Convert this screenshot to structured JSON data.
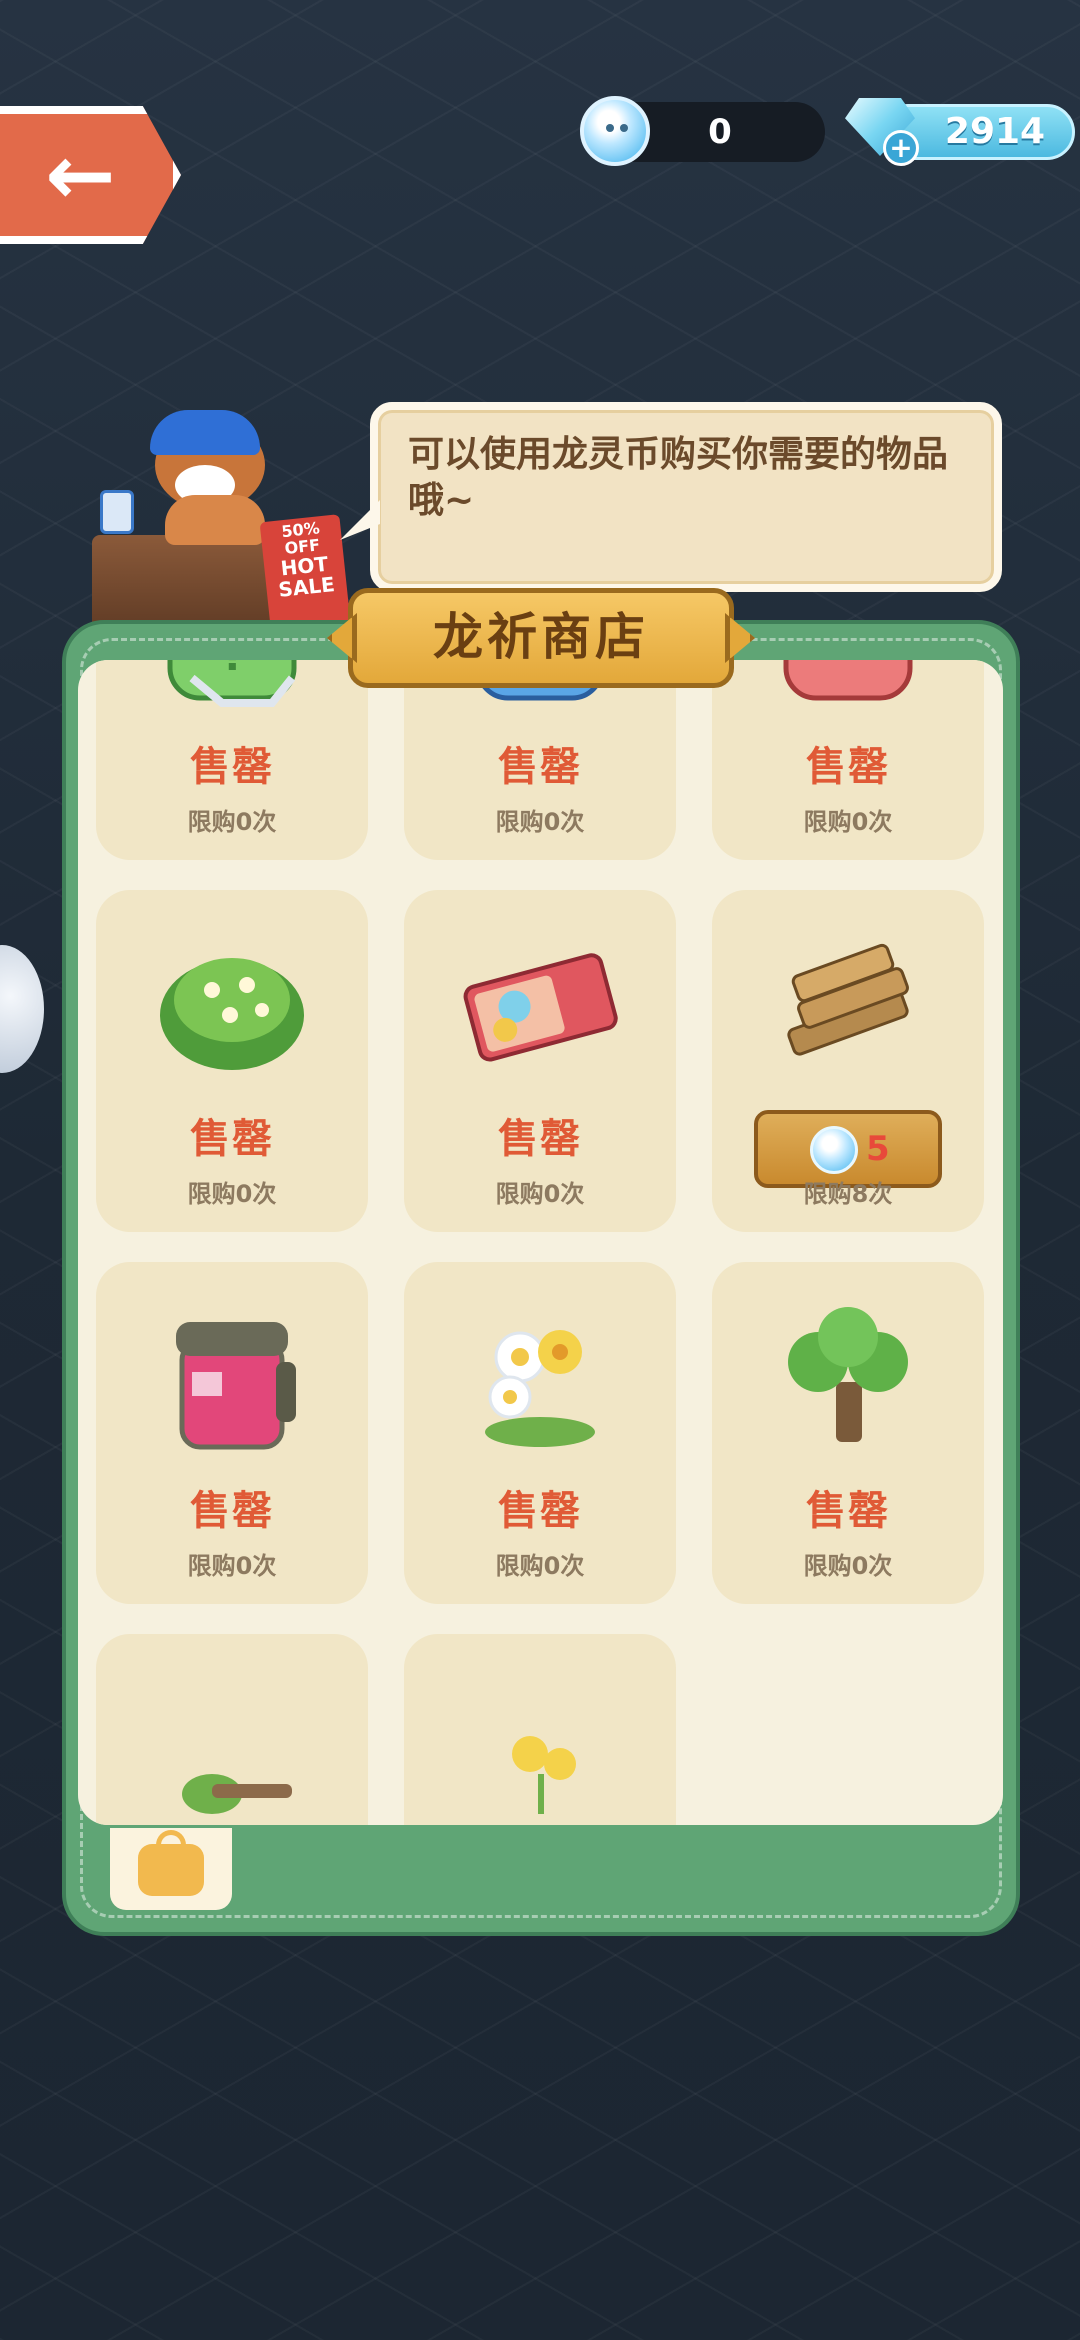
{
  "currency": {
    "dragon_coin": "0",
    "gems": "2914"
  },
  "shopkeeper": {
    "sign_discount": "50%",
    "sign_off": "OFF",
    "sign_hot": "HOT",
    "sign_sale": "SALE"
  },
  "dialog": {
    "text": "可以使用龙灵币购买你需要的物品哦~"
  },
  "shop": {
    "title": "龙祈商店",
    "items": [
      {
        "art": "green-gift-bag-icon",
        "status": "售罄",
        "limit": "限购0次"
      },
      {
        "art": "blue-gift-bag-icon",
        "status": "售罄",
        "limit": "限购0次"
      },
      {
        "art": "red-gift-bag-icon",
        "status": "售罄",
        "limit": "限购0次"
      },
      {
        "art": "flower-bush-icon",
        "status": "售罄",
        "limit": "限购0次"
      },
      {
        "art": "ticket-icon",
        "status": "售罄",
        "limit": "限购0次"
      },
      {
        "art": "wood-logs-icon",
        "price": "5",
        "limit": "限购8次"
      },
      {
        "art": "jar-icon",
        "status": "售罄",
        "limit": "限购0次"
      },
      {
        "art": "daisy-flowers-icon",
        "status": "售罄",
        "limit": "限购0次"
      },
      {
        "art": "tree-icon",
        "status": "售罄",
        "limit": "限购0次"
      },
      {
        "art": "plant-decor-icon"
      },
      {
        "art": "yellow-flowers-icon"
      }
    ]
  }
}
